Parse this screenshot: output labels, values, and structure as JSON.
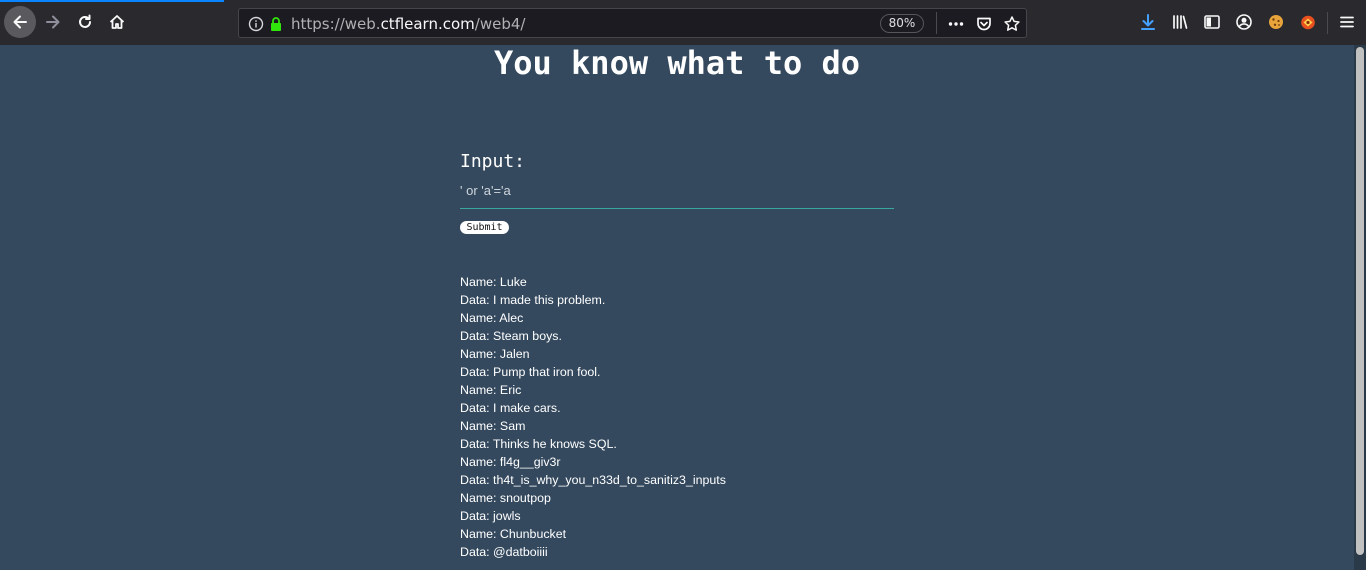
{
  "browser": {
    "url_prefix": "https://web.",
    "url_host": "ctflearn.com",
    "url_path": "/web4/",
    "zoom": "80%"
  },
  "page": {
    "title": "You know what to do",
    "input_label": "Input:",
    "input_value": "' or 'a'='a",
    "submit_label": "Submit"
  },
  "results": [
    {
      "name": "Name: Luke",
      "data": "Data: I made this problem."
    },
    {
      "name": "Name: Alec",
      "data": "Data: Steam boys."
    },
    {
      "name": "Name: Jalen",
      "data": "Data: Pump that iron fool."
    },
    {
      "name": "Name: Eric",
      "data": "Data: I make cars."
    },
    {
      "name": "Name: Sam",
      "data": "Data: Thinks he knows SQL."
    },
    {
      "name": "Name: fl4g__giv3r",
      "data": "Data: th4t_is_why_you_n33d_to_sanitiz3_inputs"
    },
    {
      "name": "Name: snoutpop",
      "data": "Data: jowls"
    },
    {
      "name": "Name: Chunbucket",
      "data": "Data: @datboiiii"
    }
  ]
}
